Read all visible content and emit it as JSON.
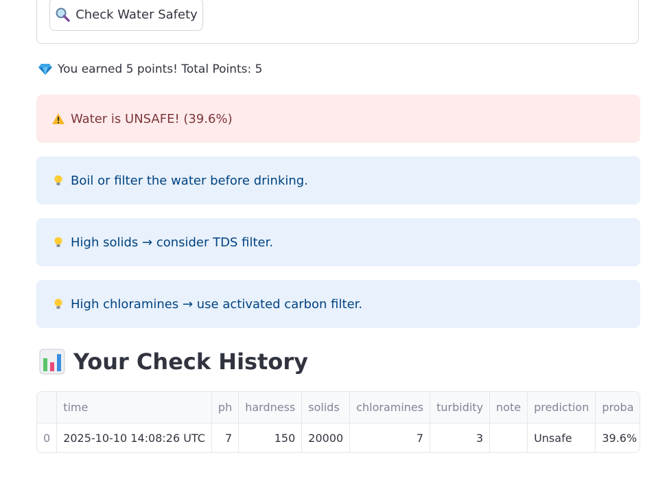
{
  "form": {
    "check_button_label": "Check Water Safety"
  },
  "points_message": "You earned 5 points! Total Points: 5",
  "alerts": {
    "result": "Water is UNSAFE! (39.6%)",
    "tips": [
      "Boil or filter the water before drinking.",
      "High solids → consider TDS filter.",
      "High chloramines → use activated carbon filter."
    ]
  },
  "history": {
    "title": "Your Check History",
    "columns": [
      "",
      "time",
      "ph",
      "hardness",
      "solids",
      "chloramines",
      "turbidity",
      "note",
      "prediction",
      "proba"
    ],
    "rows": [
      [
        "0",
        "2025-10-10 14:08:26 UTC",
        "7",
        "150",
        "20000",
        "7",
        "3",
        "",
        "Unsafe",
        "39.6%"
      ]
    ]
  },
  "colors": {
    "error_bg": "#ffebeb",
    "error_text": "#7d353b",
    "info_bg": "#e8f1fc",
    "info_text": "#004280"
  }
}
